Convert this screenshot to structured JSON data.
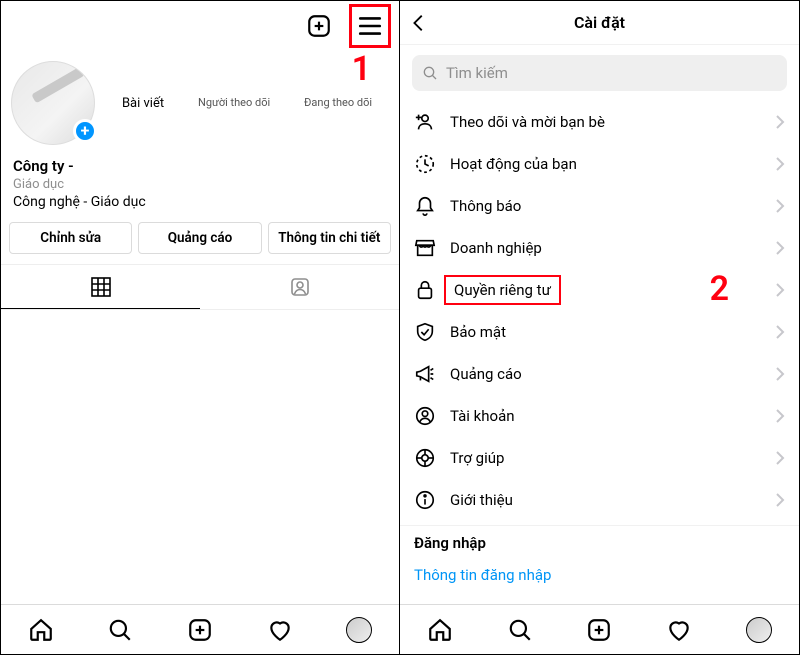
{
  "annotations": {
    "step1": "1",
    "step2": "2"
  },
  "left": {
    "stats": {
      "posts": "Bài viết",
      "followers": "Người theo dõi",
      "following": "Đang theo dõi"
    },
    "profile": {
      "title": "Công ty -",
      "category": "Giáo dục",
      "description": "Công nghệ - Giáo dục"
    },
    "buttons": {
      "edit": "Chỉnh sửa",
      "promote": "Quảng cáo",
      "insights": "Thông tin chi tiết"
    }
  },
  "right": {
    "title": "Cài đặt",
    "search_placeholder": "Tìm kiếm",
    "items": [
      {
        "label": "Theo dõi và mời bạn bè"
      },
      {
        "label": "Hoạt động của bạn"
      },
      {
        "label": "Thông báo"
      },
      {
        "label": "Doanh nghiệp"
      },
      {
        "label": "Quyền riêng tư"
      },
      {
        "label": "Bảo mật"
      },
      {
        "label": "Quảng cáo"
      },
      {
        "label": "Tài khoản"
      },
      {
        "label": "Trợ giúp"
      },
      {
        "label": "Giới thiệu"
      }
    ],
    "section": "Đăng nhập",
    "login_info": "Thông tin đăng nhập"
  }
}
